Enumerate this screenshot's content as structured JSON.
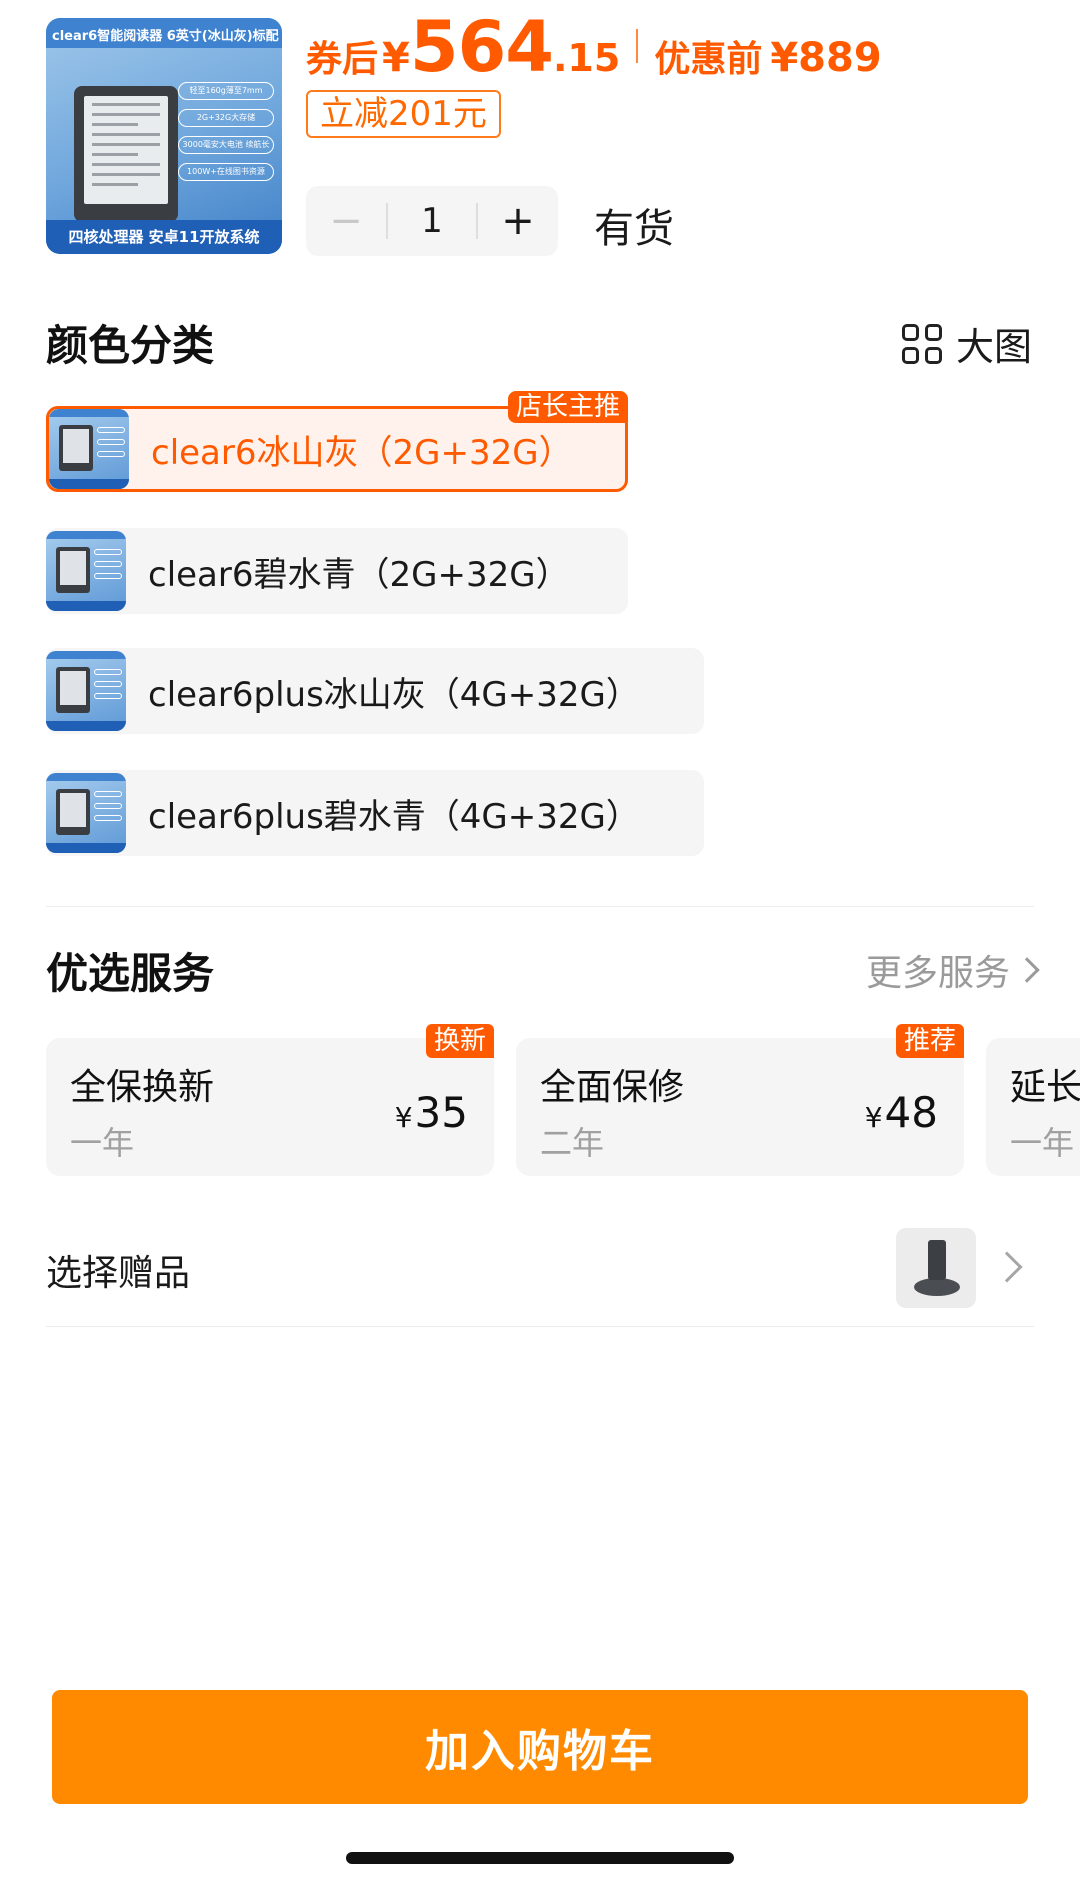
{
  "product": {
    "thumb_title": "clear6智能阅读器 6英寸(冰山灰)标配",
    "thumb_features": [
      "轻至160g薄至7mm",
      "2G+32G大存储",
      "3000毫安大电池 续航长",
      "100W+在线图书资源"
    ],
    "thumb_footer": "四核处理器 安卓11开放系统"
  },
  "price": {
    "after_label": "券后",
    "currency": "¥",
    "integer": "564",
    "decimal": ".15",
    "before_label": "优惠前",
    "before_value": "¥889",
    "discount": "立减201元",
    "accent_color": "#ff5a00"
  },
  "quantity": {
    "minus": "−",
    "value": "1",
    "plus": "+",
    "stock": "有货"
  },
  "color_section": {
    "title": "颜色分类",
    "big_image_label": "大图",
    "options": [
      {
        "label": "clear6冰山灰（2G+32G）",
        "selected": true,
        "tag": "店长主推"
      },
      {
        "label": "clear6碧水青（2G+32G）",
        "selected": false
      },
      {
        "label": "clear6plus冰山灰（4G+32G）",
        "selected": false
      },
      {
        "label": "clear6plus碧水青（4G+32G）",
        "selected": false
      }
    ]
  },
  "services": {
    "title": "优选服务",
    "more": "更多服务",
    "items": [
      {
        "name": "全保换新",
        "term": "一年",
        "currency": "¥",
        "price": "35",
        "tag": "换新"
      },
      {
        "name": "全面保修",
        "term": "二年",
        "currency": "¥",
        "price": "48",
        "tag": "推荐"
      },
      {
        "name": "延长",
        "term": "一年"
      }
    ]
  },
  "gift": {
    "label": "选择赠品"
  },
  "cta": {
    "label": "加入购物车",
    "color": "#ff8a00"
  }
}
